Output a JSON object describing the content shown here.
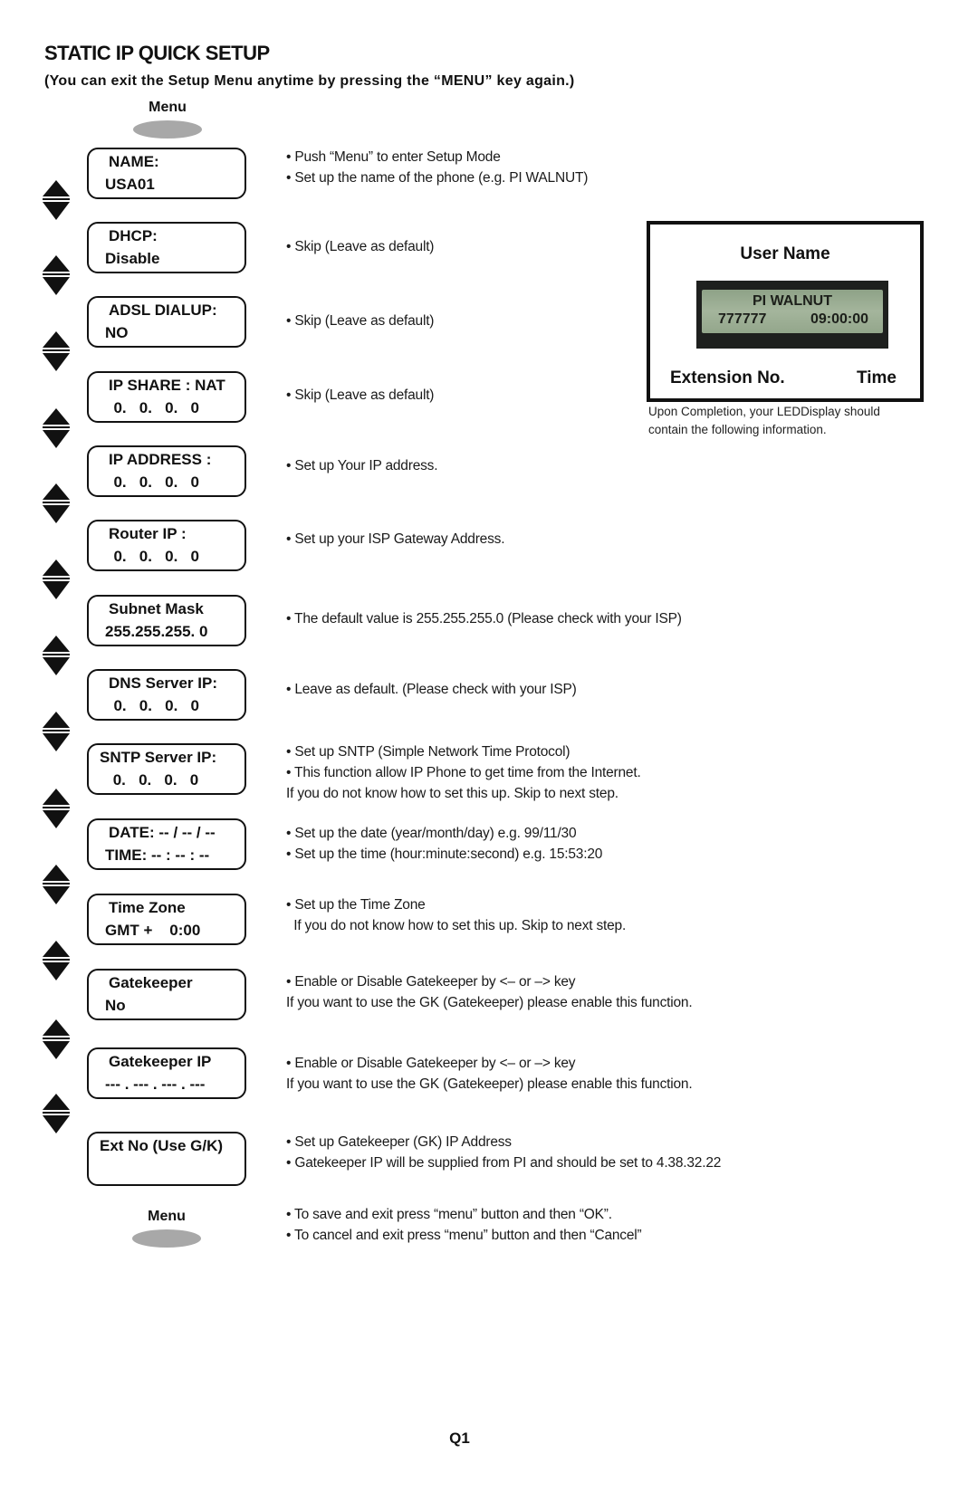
{
  "header": {
    "title": "STATIC IP QUICK SETUP",
    "subtitle": "(You can exit the Setup Menu anytime by pressing the “MENU” key again.)"
  },
  "menu_top": {
    "label": "Menu"
  },
  "menu_bottom": {
    "label": "Menu"
  },
  "steps": [
    {
      "line1": "NAME:",
      "line2": "USA01",
      "desc": [
        "• Push “Menu” to enter Setup Mode",
        "• Set up the name of the phone (e.g. PI WALNUT)"
      ]
    },
    {
      "line1": "DHCP:",
      "line2": "Disable",
      "desc": [
        "• Skip (Leave as default)"
      ]
    },
    {
      "line1": "ADSL DIALUP:",
      "line2": "NO",
      "desc": [
        "• Skip (Leave as default)"
      ]
    },
    {
      "line1": "IP SHARE : NAT",
      "line2": "  0.   0.   0.   0",
      "desc": [
        "• Skip (Leave as default)"
      ]
    },
    {
      "line1": "IP ADDRESS :",
      "line2": "  0.   0.   0.   0",
      "desc": [
        "• Set up Your IP address."
      ]
    },
    {
      "line1": "Router IP :",
      "line2": "  0.   0.   0.   0",
      "desc": [
        "• Set up your ISP Gateway Address."
      ]
    },
    {
      "line1": "Subnet Mask",
      "line2": "255.255.255. 0",
      "desc": [
        "• The default value is 255.255.255.0 (Please check with your ISP)"
      ]
    },
    {
      "line1": "DNS Server IP:",
      "line2": "  0.   0.   0.   0",
      "desc": [
        "• Leave as default. (Please check with your ISP)"
      ]
    },
    {
      "line1": "SNTP Server IP:",
      "line2": " 0.   0.   0.   0",
      "desc": [
        "• Set up SNTP (Simple Network Time Protocol)",
        "• This function allow IP Phone to get time from the Internet.",
        "If you do not know how to set this up. Skip to next step."
      ]
    },
    {
      "line1": "DATE: -- / -- / --",
      "line2": "TIME: -- : -- : --",
      "desc": [
        "• Set up the date (year/month/day) e.g. 99/11/30",
        "• Set up the time (hour:minute:second) e.g. 15:53:20"
      ]
    },
    {
      "line1": "Time Zone",
      "line2": "GMT +    0:00",
      "desc": [
        "• Set up the Time Zone",
        "  If you do not know how to set this up. Skip to next step."
      ]
    },
    {
      "line1": "Gatekeeper",
      "line2": "No",
      "desc": [
        "• Enable or Disable Gatekeeper by <– or –> key",
        "If you want to use the GK (Gatekeeper) please enable this function."
      ]
    },
    {
      "line1": "Gatekeeper IP",
      "line2": "--- . --- . --- . ---",
      "desc": [
        "• Enable or Disable Gatekeeper by <– or –> key",
        "If you want to use the GK (Gatekeeper) please enable this function."
      ]
    },
    {
      "line1": "Ext No (Use G/K)",
      "line2": "",
      "desc": [
        "• Set up Gatekeeper (GK) IP Address",
        "• Gatekeeper IP will be supplied from PI and should be set to 4.38.32.22"
      ]
    }
  ],
  "final_desc": [
    "• To save and exit press “menu” button and then “OK”.",
    "• To cancel and exit press “menu” button and then “Cancel”"
  ],
  "display_panel": {
    "user_name_label": "User Name",
    "screen_line1": "PI WALNUT",
    "screen_ext": "777777",
    "screen_time": "09:00:00",
    "extension_label": "Extension No.",
    "time_label": "Time",
    "caption": [
      "Upon Completion, your LEDDisplay should",
      "contain the following information."
    ]
  },
  "footer": {
    "page_number": "Q1"
  },
  "colors": {
    "menu_button": "#a8a8a8",
    "lcd_screen": "#9aad92",
    "lcd_bezel": "#1e201e"
  }
}
